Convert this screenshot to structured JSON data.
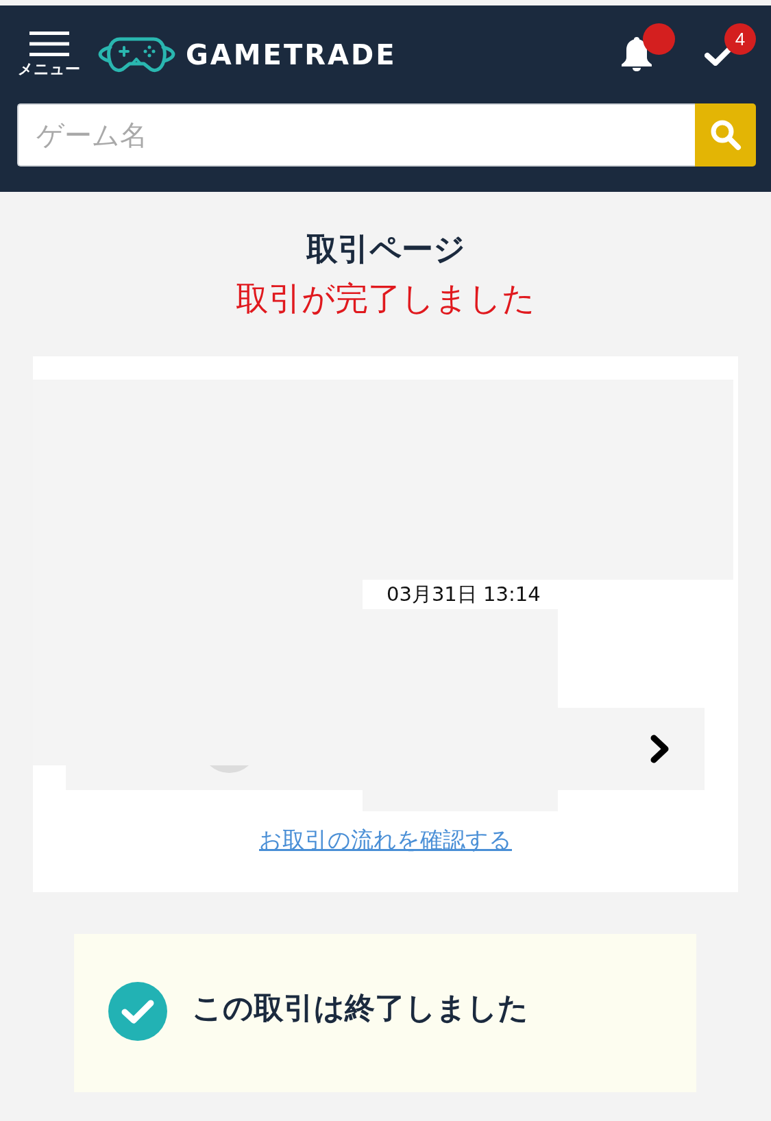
{
  "header": {
    "menu_label": "メニュー",
    "logo_text": "GAMETRADE",
    "notifications": {
      "unread": true
    },
    "todo_badge": "4"
  },
  "search": {
    "placeholder": "ゲーム名"
  },
  "page": {
    "title": "取引ページ",
    "status": "取引が完了しました"
  },
  "transaction": {
    "timestamp": "03月31日 13:14",
    "flow_link": "お取引の流れを確認する"
  },
  "notice": {
    "text": "この取引は終了しました"
  }
}
